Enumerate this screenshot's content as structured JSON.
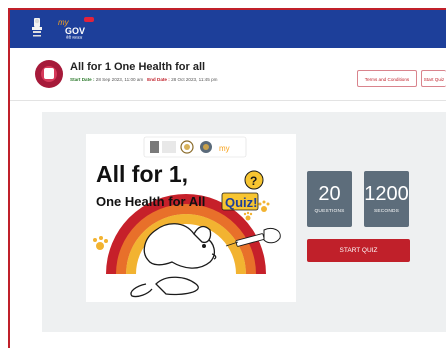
{
  "header": {
    "logo_text": "my GOV",
    "logo_hindi": "मेरी सरकार"
  },
  "quiz": {
    "title": "All for 1 One Health for all",
    "start_label": "Start Date :",
    "start_date": "28 Sep 2023, 11:00 am",
    "end_label": "End Date :",
    "end_date": "28 Oct 2023, 11:45 pm",
    "terms_button": "Terms and Conditions",
    "start_quiz_top_button": "Start Quiz",
    "questions_count": "20",
    "questions_label": "QUESTIONS",
    "seconds_count": "1200",
    "seconds_label": "SECONDS",
    "start_button": "START QUIZ"
  },
  "banner": {
    "line1": "All for 1,",
    "line2": "One Health for All",
    "quiz_word": "Quiz!",
    "question_mark": "?"
  },
  "colors": {
    "header_bg": "#1d3f9a",
    "accent_red": "#c0202a",
    "stat_bg": "#5d6d7b",
    "panel_bg": "#eef0f1"
  }
}
